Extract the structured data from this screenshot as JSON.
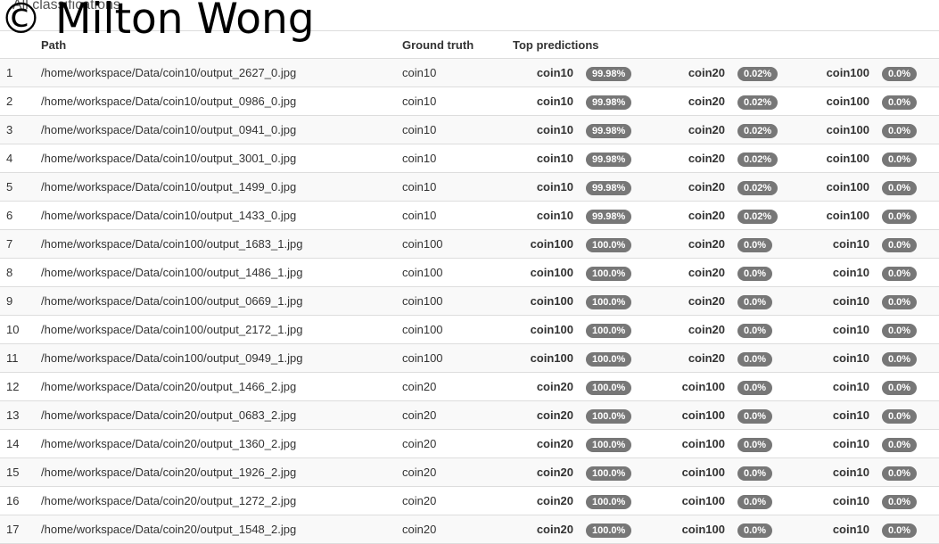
{
  "page": {
    "heading": "All classifications",
    "watermark": "© Milton Wong"
  },
  "table": {
    "headers": {
      "path": "Path",
      "ground_truth": "Ground truth",
      "top_predictions": "Top predictions"
    },
    "rows": [
      {
        "index": "1",
        "path": "/home/workspace/Data/coin10/output_2627_0.jpg",
        "ground_truth": "coin10",
        "predictions": [
          {
            "label": "coin10",
            "prob": "99.98%"
          },
          {
            "label": "coin20",
            "prob": "0.02%"
          },
          {
            "label": "coin100",
            "prob": "0.0%"
          }
        ]
      },
      {
        "index": "2",
        "path": "/home/workspace/Data/coin10/output_0986_0.jpg",
        "ground_truth": "coin10",
        "predictions": [
          {
            "label": "coin10",
            "prob": "99.98%"
          },
          {
            "label": "coin20",
            "prob": "0.02%"
          },
          {
            "label": "coin100",
            "prob": "0.0%"
          }
        ]
      },
      {
        "index": "3",
        "path": "/home/workspace/Data/coin10/output_0941_0.jpg",
        "ground_truth": "coin10",
        "predictions": [
          {
            "label": "coin10",
            "prob": "99.98%"
          },
          {
            "label": "coin20",
            "prob": "0.02%"
          },
          {
            "label": "coin100",
            "prob": "0.0%"
          }
        ]
      },
      {
        "index": "4",
        "path": "/home/workspace/Data/coin10/output_3001_0.jpg",
        "ground_truth": "coin10",
        "predictions": [
          {
            "label": "coin10",
            "prob": "99.98%"
          },
          {
            "label": "coin20",
            "prob": "0.02%"
          },
          {
            "label": "coin100",
            "prob": "0.0%"
          }
        ]
      },
      {
        "index": "5",
        "path": "/home/workspace/Data/coin10/output_1499_0.jpg",
        "ground_truth": "coin10",
        "predictions": [
          {
            "label": "coin10",
            "prob": "99.98%"
          },
          {
            "label": "coin20",
            "prob": "0.02%"
          },
          {
            "label": "coin100",
            "prob": "0.0%"
          }
        ]
      },
      {
        "index": "6",
        "path": "/home/workspace/Data/coin10/output_1433_0.jpg",
        "ground_truth": "coin10",
        "predictions": [
          {
            "label": "coin10",
            "prob": "99.98%"
          },
          {
            "label": "coin20",
            "prob": "0.02%"
          },
          {
            "label": "coin100",
            "prob": "0.0%"
          }
        ]
      },
      {
        "index": "7",
        "path": "/home/workspace/Data/coin100/output_1683_1.jpg",
        "ground_truth": "coin100",
        "predictions": [
          {
            "label": "coin100",
            "prob": "100.0%"
          },
          {
            "label": "coin20",
            "prob": "0.0%"
          },
          {
            "label": "coin10",
            "prob": "0.0%"
          }
        ]
      },
      {
        "index": "8",
        "path": "/home/workspace/Data/coin100/output_1486_1.jpg",
        "ground_truth": "coin100",
        "predictions": [
          {
            "label": "coin100",
            "prob": "100.0%"
          },
          {
            "label": "coin20",
            "prob": "0.0%"
          },
          {
            "label": "coin10",
            "prob": "0.0%"
          }
        ]
      },
      {
        "index": "9",
        "path": "/home/workspace/Data/coin100/output_0669_1.jpg",
        "ground_truth": "coin100",
        "predictions": [
          {
            "label": "coin100",
            "prob": "100.0%"
          },
          {
            "label": "coin20",
            "prob": "0.0%"
          },
          {
            "label": "coin10",
            "prob": "0.0%"
          }
        ]
      },
      {
        "index": "10",
        "path": "/home/workspace/Data/coin100/output_2172_1.jpg",
        "ground_truth": "coin100",
        "predictions": [
          {
            "label": "coin100",
            "prob": "100.0%"
          },
          {
            "label": "coin20",
            "prob": "0.0%"
          },
          {
            "label": "coin10",
            "prob": "0.0%"
          }
        ]
      },
      {
        "index": "11",
        "path": "/home/workspace/Data/coin100/output_0949_1.jpg",
        "ground_truth": "coin100",
        "predictions": [
          {
            "label": "coin100",
            "prob": "100.0%"
          },
          {
            "label": "coin20",
            "prob": "0.0%"
          },
          {
            "label": "coin10",
            "prob": "0.0%"
          }
        ]
      },
      {
        "index": "12",
        "path": "/home/workspace/Data/coin20/output_1466_2.jpg",
        "ground_truth": "coin20",
        "predictions": [
          {
            "label": "coin20",
            "prob": "100.0%"
          },
          {
            "label": "coin100",
            "prob": "0.0%"
          },
          {
            "label": "coin10",
            "prob": "0.0%"
          }
        ]
      },
      {
        "index": "13",
        "path": "/home/workspace/Data/coin20/output_0683_2.jpg",
        "ground_truth": "coin20",
        "predictions": [
          {
            "label": "coin20",
            "prob": "100.0%"
          },
          {
            "label": "coin100",
            "prob": "0.0%"
          },
          {
            "label": "coin10",
            "prob": "0.0%"
          }
        ]
      },
      {
        "index": "14",
        "path": "/home/workspace/Data/coin20/output_1360_2.jpg",
        "ground_truth": "coin20",
        "predictions": [
          {
            "label": "coin20",
            "prob": "100.0%"
          },
          {
            "label": "coin100",
            "prob": "0.0%"
          },
          {
            "label": "coin10",
            "prob": "0.0%"
          }
        ]
      },
      {
        "index": "15",
        "path": "/home/workspace/Data/coin20/output_1926_2.jpg",
        "ground_truth": "coin20",
        "predictions": [
          {
            "label": "coin20",
            "prob": "100.0%"
          },
          {
            "label": "coin100",
            "prob": "0.0%"
          },
          {
            "label": "coin10",
            "prob": "0.0%"
          }
        ]
      },
      {
        "index": "16",
        "path": "/home/workspace/Data/coin20/output_1272_2.jpg",
        "ground_truth": "coin20",
        "predictions": [
          {
            "label": "coin20",
            "prob": "100.0%"
          },
          {
            "label": "coin100",
            "prob": "0.0%"
          },
          {
            "label": "coin10",
            "prob": "0.0%"
          }
        ]
      },
      {
        "index": "17",
        "path": "/home/workspace/Data/coin20/output_1548_2.jpg",
        "ground_truth": "coin20",
        "predictions": [
          {
            "label": "coin20",
            "prob": "100.0%"
          },
          {
            "label": "coin100",
            "prob": "0.0%"
          },
          {
            "label": "coin10",
            "prob": "0.0%"
          }
        ]
      }
    ]
  },
  "colors": {
    "badge_background": "#777777",
    "badge_text": "#ffffff",
    "row_border": "#dddddd"
  }
}
